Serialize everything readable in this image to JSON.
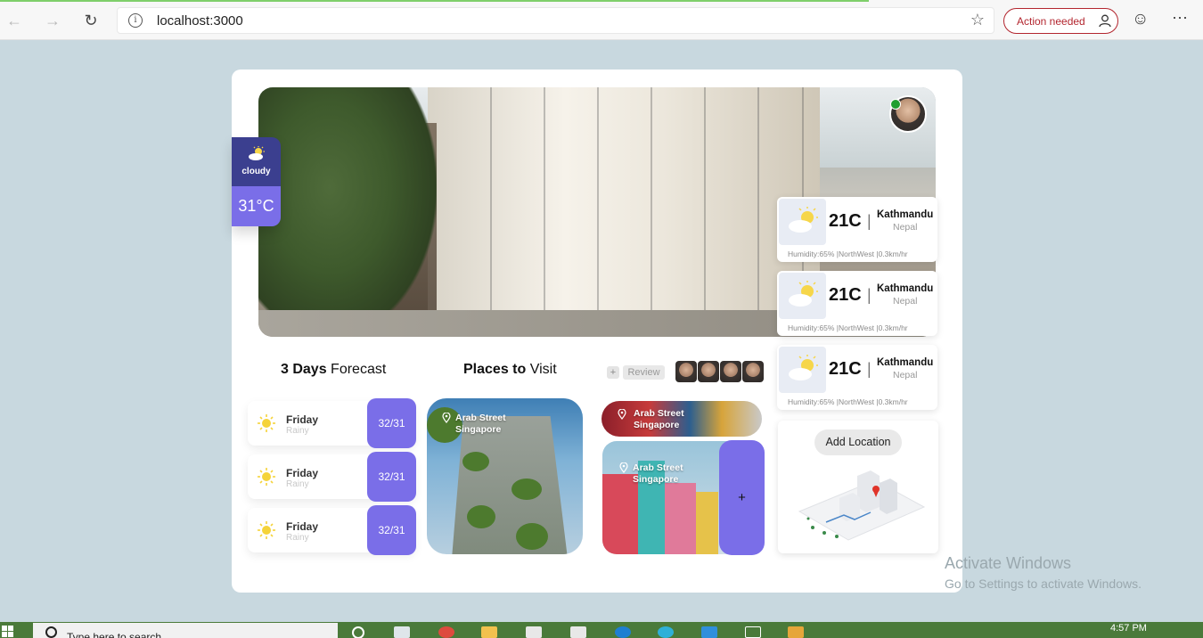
{
  "browser": {
    "url": "localhost:3000",
    "action_needed": "Action needed"
  },
  "header_weather": {
    "condition": "cloudy",
    "temperature": "31°C"
  },
  "weather_cards": [
    {
      "temp": "21C",
      "city": "Kathmandu",
      "country": "Nepal",
      "meta": "Humidity:65% |NorthWest |0.3km/hr"
    },
    {
      "temp": "21C",
      "city": "Kathmandu",
      "country": "Nepal",
      "meta": "Humidity:65% |NorthWest |0.3km/hr"
    },
    {
      "temp": "21C",
      "city": "Kathmandu",
      "country": "Nepal",
      "meta": "Humidity:65% |NorthWest |0.3km/hr"
    }
  ],
  "add_location": {
    "label": "Add Location"
  },
  "forecast": {
    "title_bold": "3 Days",
    "title_rest": " Forecast",
    "days": [
      {
        "day": "Friday",
        "condition": "Rainy",
        "temp": "32/31"
      },
      {
        "day": "Friday",
        "condition": "Rainy",
        "temp": "32/31"
      },
      {
        "day": "Friday",
        "condition": "Rainy",
        "temp": "32/31"
      }
    ]
  },
  "places": {
    "title_bold": "Places to",
    "title_rest": " Visit",
    "review_plus": "+",
    "review_label": "Review",
    "add_label": "+",
    "items": [
      {
        "line1": "Arab Street",
        "line2": "Singapore"
      },
      {
        "line1": "Arab Street",
        "line2": "Singapore"
      },
      {
        "line1": "Arab Street",
        "line2": "Singapore"
      }
    ]
  },
  "os": {
    "watermark_title": "Activate Windows",
    "watermark_sub": "Go to Settings to activate Windows.",
    "search_text": "Type here to search",
    "clock": "4:57 PM"
  },
  "colors": {
    "accent": "#7a6ee8",
    "badge_dark": "#3b3f8f",
    "page_bg": "#c8d8df",
    "action_red": "#b3262f"
  }
}
